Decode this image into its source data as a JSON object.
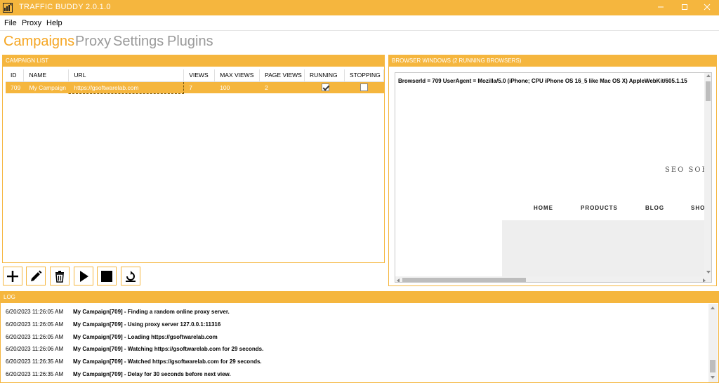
{
  "window": {
    "title": "TRAFFIC BUDDY 2.0.1.0",
    "controls": [
      "minimize",
      "maximize",
      "close"
    ]
  },
  "menu": [
    "File",
    "Proxy",
    "Help"
  ],
  "tabs": [
    {
      "label": "Campaigns",
      "active": true
    },
    {
      "label": "Proxy",
      "active": false
    },
    {
      "label": "Settings",
      "active": false
    },
    {
      "label": "Plugins",
      "active": false
    }
  ],
  "campaign_list": {
    "title": "CAMPAIGN LIST",
    "columns": [
      "ID",
      "NAME",
      "URL",
      "VIEWS",
      "MAX VIEWS",
      "PAGE VIEWS",
      "RUNNING",
      "STOPPING"
    ],
    "rows": [
      {
        "id": "709",
        "name": "My Campaign",
        "url": "https://gsoftwarelab.com",
        "views": "7",
        "max_views": "100",
        "page_views": "2",
        "running": true,
        "stopping": false
      }
    ]
  },
  "toolbar": {
    "buttons": [
      "add-icon",
      "edit-icon",
      "delete-icon",
      "play-icon",
      "stop-icon",
      "reset-icon"
    ]
  },
  "browser_windows": {
    "title": "BROWSER WINDOWS (2 RUNNING BROWSERS)",
    "info_line": "BrowserId = 709 UserAgent = Mozilla/5.0 (iPhone; CPU iPhone OS 16_5 like Mac OS X) AppleWebKit/605.1.15",
    "site_logo": "SEO SOFTW",
    "site_nav": [
      "HOME",
      "PRODUCTS",
      "BLOG",
      "SHOP"
    ]
  },
  "log": {
    "title": "LOG",
    "entries": [
      {
        "time": "6/20/2023 11:26:05 AM",
        "message": "My Campaign[709] - Finding a random online proxy server."
      },
      {
        "time": "6/20/2023 11:26:05 AM",
        "message": "My Campaign[709] - Using proxy server 127.0.0.1:11316"
      },
      {
        "time": "6/20/2023 11:26:05 AM",
        "message": "My Campaign[709] - Loading https://gsoftwarelab.com"
      },
      {
        "time": "6/20/2023 11:26:06 AM",
        "message": "My Campaign[709] - Watching https://gsoftwarelab.com for 29 seconds."
      },
      {
        "time": "6/20/2023 11:26:35 AM",
        "message": "My Campaign[709] - Watched https://gsoftwarelab.com for 29 seconds."
      },
      {
        "time": "6/20/2023 11:26:35 AM",
        "message": "My Campaign[709] - Delay for 30 seconds before next view."
      }
    ]
  },
  "colors": {
    "accent": "#f5b63e",
    "active_tab": "#f5a623",
    "inactive_tab": "#9a9a9a"
  }
}
